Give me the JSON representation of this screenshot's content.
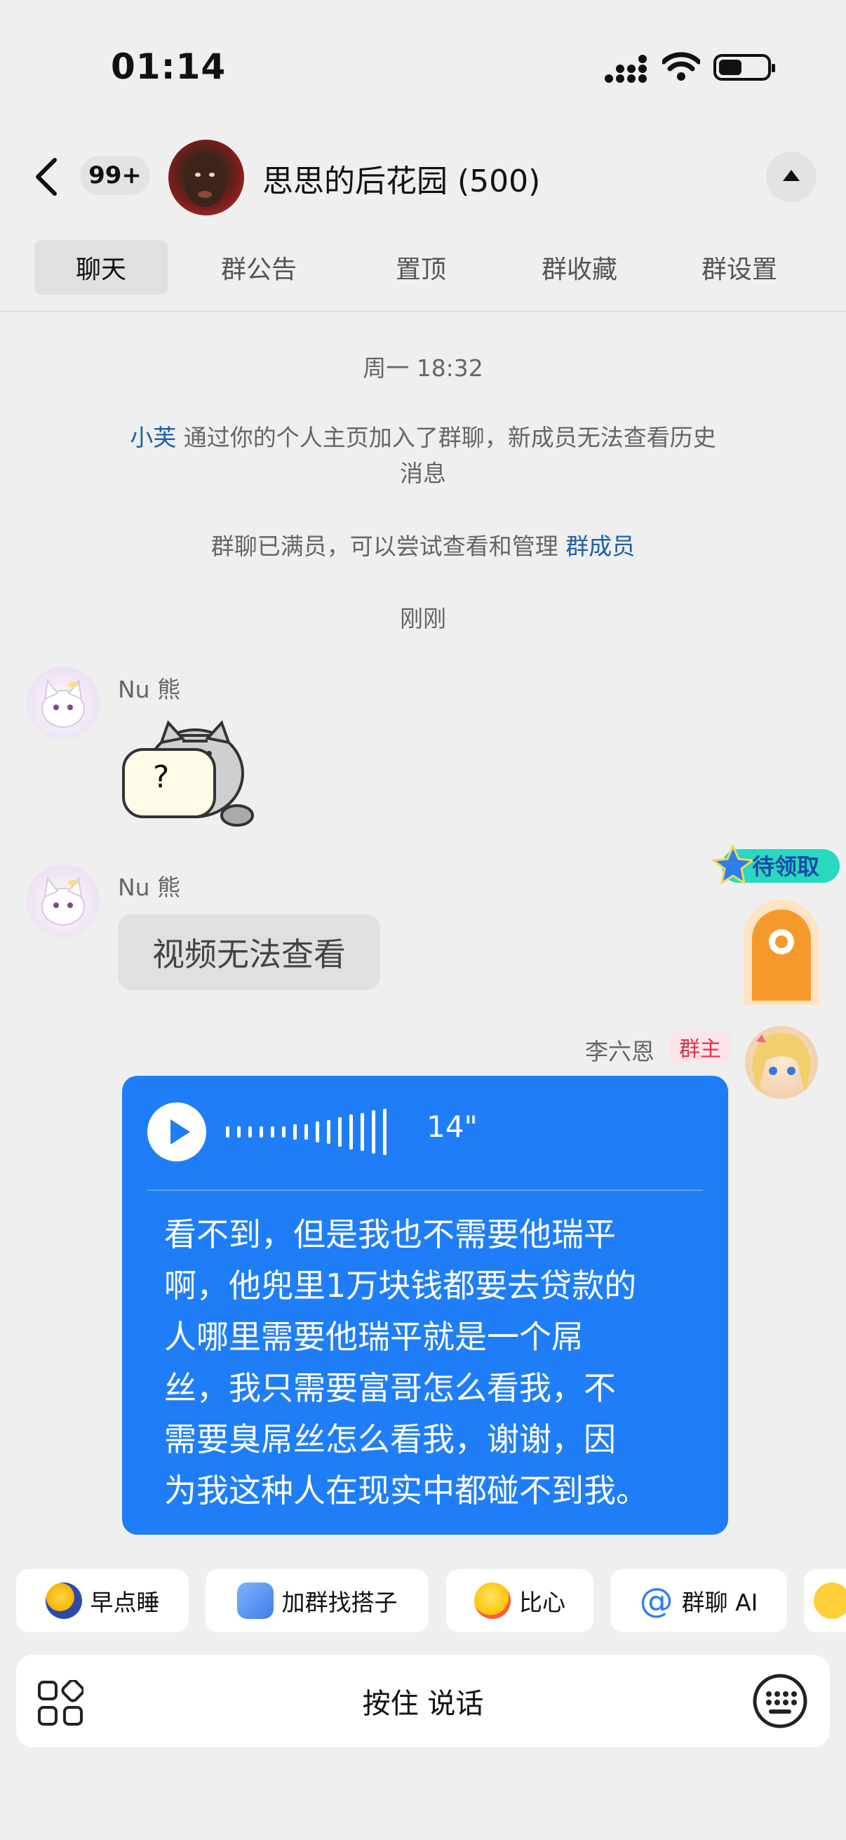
{
  "status_bar": {
    "time": "01:14"
  },
  "header": {
    "unread_badge": "99+",
    "group_name": "思思的后花园 (500)"
  },
  "tabs": [
    "聊天",
    "群公告",
    "置顶",
    "群收藏",
    "群设置"
  ],
  "messages": {
    "timestamp1": "周一 18:32",
    "join_user": "小芙",
    "join_text_line1": " 通过你的个人主页加入了群聊，新成员无法查看历史",
    "join_text_line2": "消息",
    "full_text": "群聊已满员，可以尝试查看和管理 ",
    "full_link": "群成员",
    "timestamp2": "刚刚",
    "msg1_sender": "Nu 熊",
    "msg1_sticker_text": "?",
    "msg2_sender": "Nu 熊",
    "msg2_text": "视频无法查看",
    "msg3_sender": "李六恩",
    "msg3_role": "群主",
    "msg3_duration": "14\"",
    "msg3_lines": [
      "看不到，但是我也不需要他瑞平",
      "啊，他兜里1万块钱都要去贷款的",
      "人哪里需要他瑞平就是一个屌",
      "丝，我只需要富哥怎么看我，不",
      "需要臭屌丝怎么看我，谢谢，因",
      "为我这种人在现实中都碰不到我。"
    ]
  },
  "reward_label": "待领取",
  "chips": [
    "早点睡",
    "加群找搭子",
    "比心",
    "群聊 AI"
  ],
  "input": {
    "hold_to_talk": "按住 说话"
  },
  "colors": {
    "accent": "#1f7ef7",
    "link": "#1f5fa8",
    "owner_badge": "#e0314f"
  }
}
